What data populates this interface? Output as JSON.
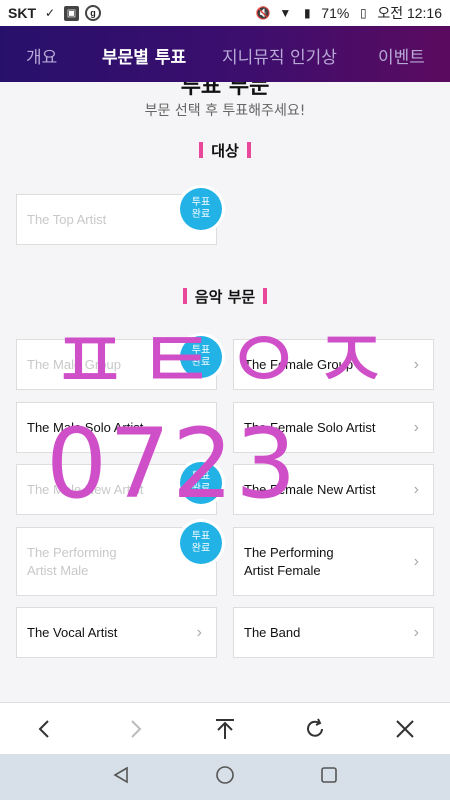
{
  "status_bar": {
    "carrier": "SKT",
    "battery": "71%",
    "time": "오전 12:16"
  },
  "nav": {
    "tabs": [
      {
        "label": "개요",
        "active": false
      },
      {
        "label": "부문별 투표",
        "active": true
      },
      {
        "label": "지니뮤직 인기상",
        "active": false
      },
      {
        "label": "이벤트",
        "active": false
      }
    ]
  },
  "header": {
    "title": "투표 부문",
    "subtitle": "부문 선택 후 투표해주세요!"
  },
  "sections": {
    "grand": {
      "title": "대상",
      "items": [
        {
          "label": "The Top Artist",
          "voted": true,
          "badge": "투표\n완료"
        }
      ]
    },
    "music": {
      "title": "음악 부문",
      "items": [
        {
          "label": "The Male Group",
          "voted": true,
          "badge": "투표\n완료"
        },
        {
          "label": "The Female Group",
          "voted": false
        },
        {
          "label": "The Male Solo Artist",
          "voted": false
        },
        {
          "label": "The Female Solo Artist",
          "voted": false
        },
        {
          "label": "The Male New Artist",
          "voted": true,
          "badge": "투표\n완료"
        },
        {
          "label": "The Female New Artist",
          "voted": false
        },
        {
          "label": "The Performing\nArtist Male",
          "voted": true,
          "badge": "투표\n완료"
        },
        {
          "label": "The Performing\nArtist Female",
          "voted": false
        },
        {
          "label": "The Vocal Artist",
          "voted": false
        },
        {
          "label": "The Band",
          "voted": false
        }
      ]
    }
  },
  "overlay": {
    "line1": "ㅍㅌㅇㅈ",
    "line2": "0723",
    "color": "#cf4fc9"
  },
  "colors": {
    "accent_pink": "#e8479a",
    "badge_blue": "#23b2e6",
    "nav_gradient_start": "#27106b",
    "nav_gradient_end": "#5b0b5f"
  },
  "browser_toolbar": {
    "icons": [
      "back-icon",
      "forward-icon",
      "scroll-top-icon",
      "refresh-icon",
      "close-icon"
    ]
  },
  "system_nav": {
    "icons": [
      "back-triangle-icon",
      "home-circle-icon",
      "recents-square-icon"
    ]
  }
}
